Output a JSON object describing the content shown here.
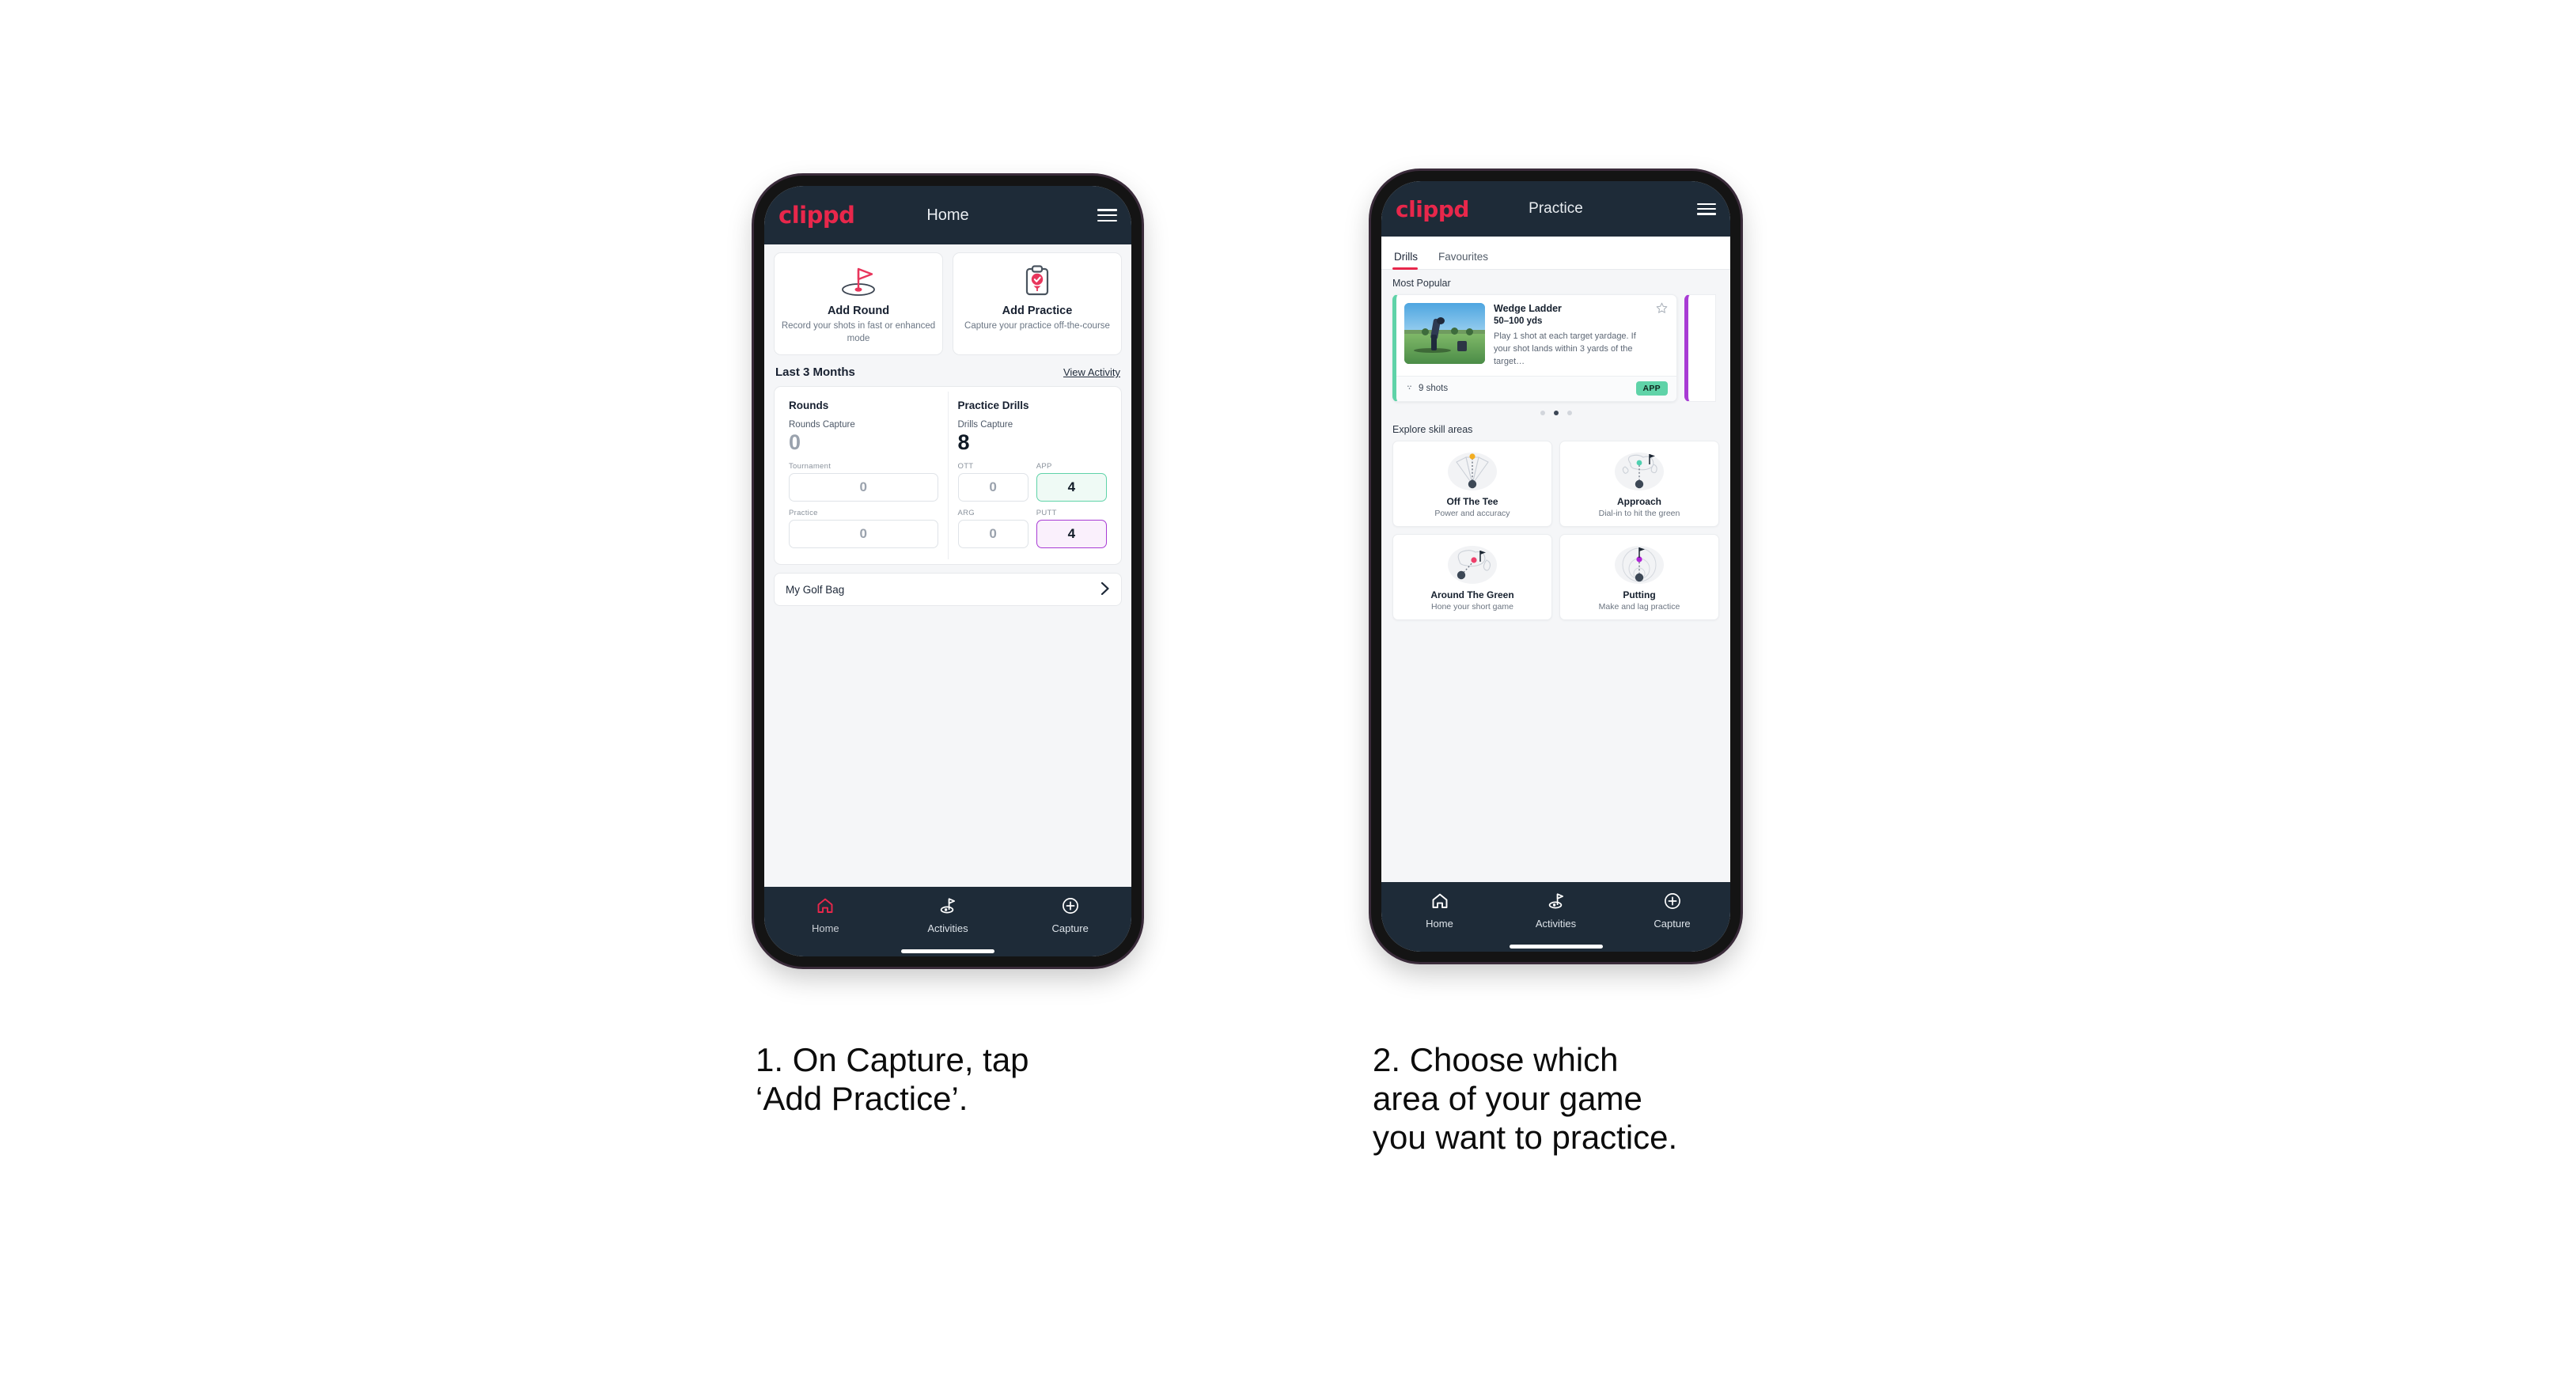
{
  "brand": {
    "logo_text": "clippd",
    "accent_pink": "#e8274b",
    "header_navy": "#1e2b38",
    "green": "#5fd3a8",
    "purple": "#a83bd4"
  },
  "phone1": {
    "header": {
      "logo": "clippd",
      "title": "Home",
      "menu_icon": "hamburger-menu-icon"
    },
    "quick_actions": [
      {
        "icon": "golf-flag-hole-icon",
        "title": "Add Round",
        "subtitle": "Record your shots in fast or enhanced mode"
      },
      {
        "icon": "clipboard-check-icon",
        "title": "Add Practice",
        "subtitle": "Capture your practice off-the-course"
      }
    ],
    "section": {
      "title": "Last 3 Months",
      "link": "View Activity"
    },
    "stats": {
      "rounds": {
        "title": "Rounds",
        "capture_label": "Rounds Capture",
        "capture_value": "0",
        "metrics": [
          {
            "label": "Tournament",
            "value": "0",
            "style": "plain"
          },
          {
            "label": "Practice",
            "value": "0",
            "style": "plain"
          }
        ]
      },
      "drills": {
        "title": "Practice Drills",
        "capture_label": "Drills Capture",
        "capture_value": "8",
        "metrics": [
          {
            "label": "OTT",
            "value": "0",
            "style": "plain"
          },
          {
            "label": "APP",
            "value": "4",
            "style": "green"
          },
          {
            "label": "ARG",
            "value": "0",
            "style": "plain"
          },
          {
            "label": "PUTT",
            "value": "4",
            "style": "purple"
          }
        ]
      }
    },
    "golf_bag": {
      "label": "My Golf Bag",
      "chevron": "chevron-right-icon"
    },
    "bottom_nav": [
      {
        "icon": "home-icon",
        "label": "Home",
        "active": true
      },
      {
        "icon": "golf-flag-icon",
        "label": "Activities",
        "active": false
      },
      {
        "icon": "plus-circle-icon",
        "label": "Capture",
        "active": false
      }
    ]
  },
  "phone2": {
    "header": {
      "logo": "clippd",
      "title": "Practice",
      "menu_icon": "hamburger-menu-icon"
    },
    "tabs": [
      {
        "label": "Drills",
        "active": true
      },
      {
        "label": "Favourites",
        "active": false
      }
    ],
    "most_popular_label": "Most Popular",
    "drill_card": {
      "thumbnail": "golfer-chipping-photo",
      "title": "Wedge Ladder",
      "yardage": "50–100 yds",
      "description": "Play 1 shot at each target yardage. If your shot lands within 3 yards of the target…",
      "favourite_icon": "star-outline-icon",
      "shots_icon": "shots-clock-icon",
      "shots": "9 shots",
      "badge": "APP",
      "accent": "#5fd3a8"
    },
    "carousel": {
      "dots": 3,
      "active_index": 1
    },
    "explore_label": "Explore skill areas",
    "skill_areas": [
      {
        "icon": "tee-dispersion-icon",
        "title": "Off The Tee",
        "subtitle": "Power and accuracy"
      },
      {
        "icon": "green-approach-icon",
        "title": "Approach",
        "subtitle": "Dial-in to hit the green"
      },
      {
        "icon": "chip-around-green-icon",
        "title": "Around The Green",
        "subtitle": "Hone your short game"
      },
      {
        "icon": "putting-rings-icon",
        "title": "Putting",
        "subtitle": "Make and lag practice"
      }
    ],
    "bottom_nav": [
      {
        "icon": "home-icon",
        "label": "Home",
        "active": false
      },
      {
        "icon": "golf-flag-icon",
        "label": "Activities",
        "active": false
      },
      {
        "icon": "plus-circle-icon",
        "label": "Capture",
        "active": false
      }
    ]
  },
  "captions": {
    "step1": "1. On Capture, tap\n‘Add Practice’.",
    "step2": "2. Choose which\narea of your game\nyou want to practice."
  }
}
